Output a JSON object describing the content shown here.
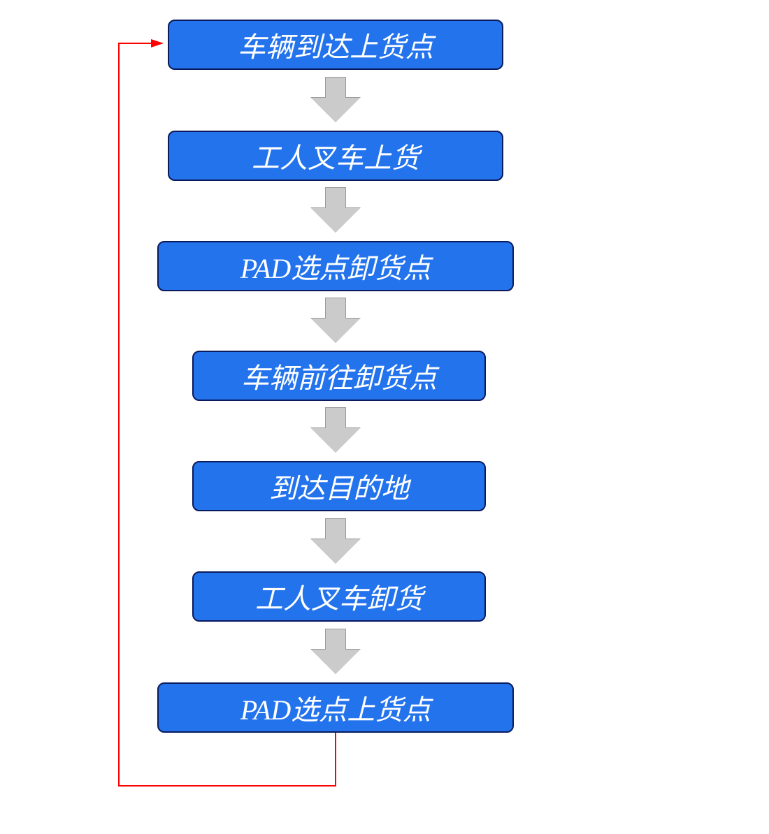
{
  "flowchart": {
    "steps": [
      {
        "label": "车辆到达上货点"
      },
      {
        "label": "工人叉车上货"
      },
      {
        "label": "PAD选点卸货点"
      },
      {
        "label": "车辆前往卸货点"
      },
      {
        "label": "到达目的地"
      },
      {
        "label": "工人叉车卸货"
      },
      {
        "label": "PAD选点上货点"
      }
    ],
    "colors": {
      "box_fill": "#2373ed",
      "box_border": "#0a1a5c",
      "box_text": "#ffffff",
      "arrow_fill": "#cbcbcb",
      "arrow_border": "#9a9a9a",
      "feedback_line": "#ff0000"
    }
  }
}
